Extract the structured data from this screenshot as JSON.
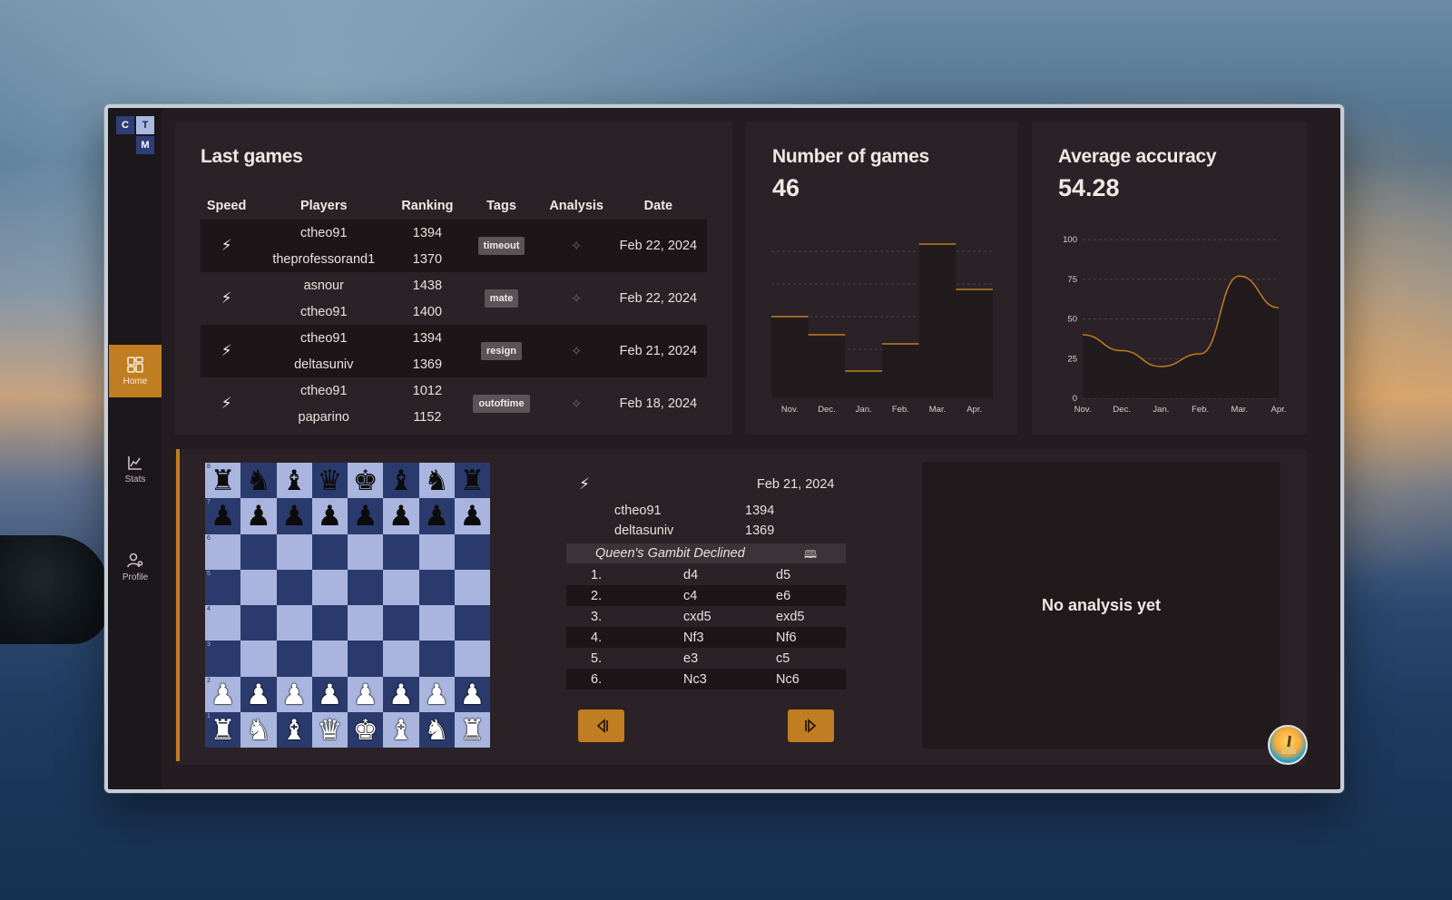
{
  "logo": {
    "c": "C",
    "t": "T",
    "m": "M"
  },
  "nav": [
    {
      "label": "Home",
      "icon": "dashboard-icon",
      "active": true
    },
    {
      "label": "Stats",
      "icon": "chart-icon",
      "active": false
    },
    {
      "label": "Profile",
      "icon": "user-settings-icon",
      "active": false
    }
  ],
  "last_games": {
    "title": "Last games",
    "headers": [
      "Speed",
      "Players",
      "Ranking",
      "Tags",
      "Analysis",
      "Date"
    ],
    "rows": [
      {
        "p1": "ctheo91",
        "r1": "1394",
        "p2": "theprofessorand1",
        "r2": "1370",
        "tag": "timeout",
        "date": "Feb 22, 2024"
      },
      {
        "p1": "asnour",
        "r1": "1438",
        "p2": "ctheo91",
        "r2": "1400",
        "tag": "mate",
        "date": "Feb 22, 2024"
      },
      {
        "p1": "ctheo91",
        "r1": "1394",
        "p2": "deltasuniv",
        "r2": "1369",
        "tag": "resign",
        "date": "Feb 21, 2024"
      },
      {
        "p1": "ctheo91",
        "r1": "1012",
        "p2": "paparino",
        "r2": "1152",
        "tag": "outoftime",
        "date": "Feb 18, 2024"
      }
    ]
  },
  "games_count": {
    "title": "Number of games",
    "value": "46"
  },
  "accuracy": {
    "title": "Average accuracy",
    "value": "54.28"
  },
  "chart_data": [
    {
      "type": "bar",
      "title": "Number of games",
      "categories": [
        "Nov.",
        "Dec.",
        "Jan.",
        "Feb.",
        "Mar.",
        "Apr."
      ],
      "values": [
        9,
        7,
        3,
        6,
        17,
        12
      ],
      "ylim": [
        0,
        18
      ],
      "grid": true,
      "color": "#c17d21"
    },
    {
      "type": "line",
      "title": "Average accuracy",
      "categories": [
        "Nov.",
        "Dec.",
        "Jan.",
        "Feb.",
        "Mar.",
        "Apr."
      ],
      "y_ticks": [
        0,
        25,
        50,
        75,
        100
      ],
      "values": [
        40,
        30,
        20,
        28,
        77,
        57
      ],
      "ylim": [
        0,
        100
      ],
      "grid": true,
      "color": "#c17d21"
    }
  ],
  "game_detail": {
    "date": "Feb 21, 2024",
    "white": "ctheo91",
    "white_rating": "1394",
    "black": "deltasuniv",
    "black_rating": "1369",
    "opening": "Queen's Gambit Declined",
    "moves": [
      {
        "n": "1.",
        "w": "d4",
        "b": "d5"
      },
      {
        "n": "2.",
        "w": "c4",
        "b": "e6"
      },
      {
        "n": "3.",
        "w": "cxd5",
        "b": "exd5"
      },
      {
        "n": "4.",
        "w": "Nf3",
        "b": "Nf6"
      },
      {
        "n": "5.",
        "w": "e3",
        "b": "c5"
      },
      {
        "n": "6.",
        "w": "Nc3",
        "b": "Nc6"
      }
    ]
  },
  "board": {
    "rows": [
      "rnbqkbnr",
      "pppppppp",
      "........",
      "........",
      "........",
      "........",
      "PPPPPPPP",
      "RNBQKBNR"
    ],
    "light": "#a9b5de",
    "dark": "#2b3a6c"
  },
  "analysis": {
    "empty_text": "No analysis yet"
  }
}
